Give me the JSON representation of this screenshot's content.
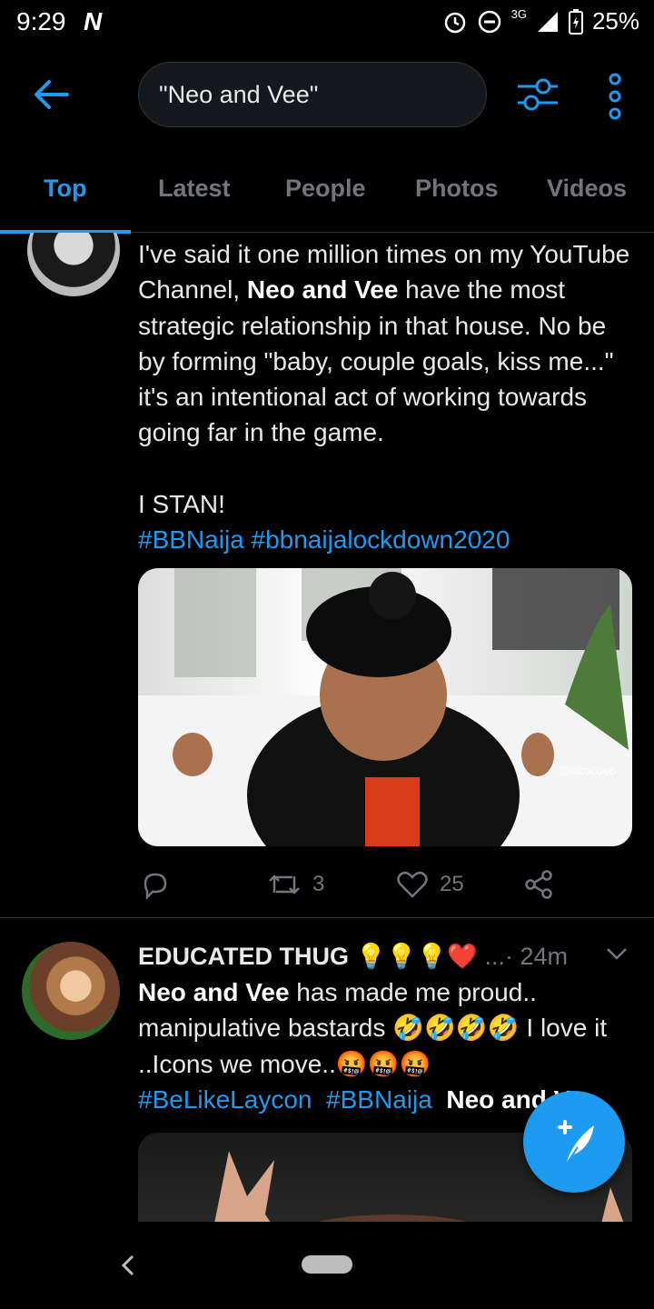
{
  "status_bar": {
    "time": "9:29",
    "network": "3G",
    "battery": "25%"
  },
  "search": {
    "query": "\"Neo and Vee\""
  },
  "tabs": [
    {
      "label": "Top",
      "active": true
    },
    {
      "label": "Latest",
      "active": false
    },
    {
      "label": "People",
      "active": false
    },
    {
      "label": "Photos",
      "active": false
    },
    {
      "label": "Videos",
      "active": false
    }
  ],
  "tweet1": {
    "text_before": "I've said it one million times on my YouTube Channel,  ",
    "highlight": "Neo and Vee",
    "text_after": " have the most strategic relationship in that house. No be by forming \"baby, couple goals, kiss me...\" it's an intentional act of working towards going far in the game.",
    "text_stan": "I STAN!",
    "hashtags": "#BBNaija #bbnaijalockdown2020",
    "media_watermark": "@lilcocooo",
    "retweets": "3",
    "likes": "25"
  },
  "tweet2": {
    "name": "EDUCATED THUG",
    "name_emojis": "💡💡💡❤️",
    "meta": "...· 24m",
    "highlight": "Neo and Vee",
    "text1": " has made me proud.. manipulative bastards ",
    "emojis1": "🤣🤣🤣🤣",
    "text2": " I love it ..Icons we move..",
    "emojis2": "🤬🤬🤬",
    "hashtag1": "#BeLikeLaycon",
    "hashtag2": "#BBNaija",
    "trailing": "Neo and Vee"
  },
  "colors": {
    "accent": "#1d9bf0",
    "muted": "#71767b",
    "background": "#000000"
  },
  "icons": {
    "back": "arrow-left-icon",
    "filter": "sliders-icon",
    "more": "vertical-dots-icon",
    "reply": "reply-icon",
    "retweet": "retweet-icon",
    "like": "heart-icon",
    "share": "share-icon",
    "compose": "compose-feather-icon"
  }
}
